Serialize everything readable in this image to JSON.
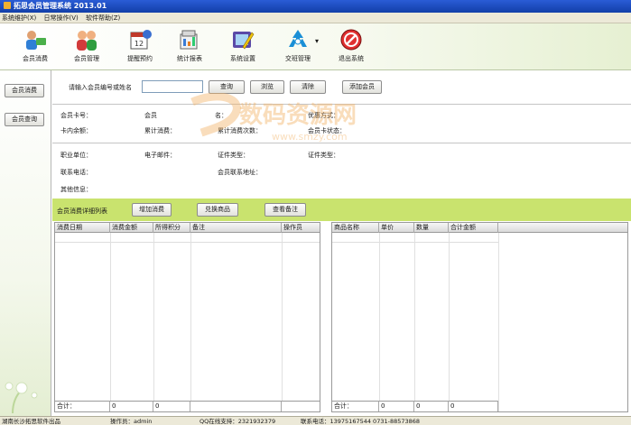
{
  "window": {
    "title": "拓思会员管理系统  2013.01"
  },
  "menu": [
    "系统维护(X)",
    "日常操作(V)",
    "软件帮助(Z)"
  ],
  "toolbar": [
    {
      "label": "会员消费",
      "icon": "member-consume-icon"
    },
    {
      "label": "会员管理",
      "icon": "member-manage-icon"
    },
    {
      "label": "提醒预约",
      "icon": "calendar-reminder-icon"
    },
    {
      "label": "统计报表",
      "icon": "report-icon"
    },
    {
      "label": "系统设置",
      "icon": "settings-icon"
    },
    {
      "label": "交班管理",
      "icon": "shift-handover-icon"
    },
    {
      "label": "退出系统",
      "icon": "exit-icon"
    }
  ],
  "leftnav": [
    "会员消费",
    "会员查询"
  ],
  "search": {
    "prompt": "请输入会员编号或姓名",
    "value": "",
    "query_label": "查询",
    "browse_label": "浏览",
    "clear_label": "清除",
    "add_label": "添加会员"
  },
  "info": {
    "card_no": "会员卡号：",
    "member_x": "会员",
    "name_x": "名：",
    "discount": "优惠方式：",
    "balance": "卡内余额：",
    "total_consume": "累计消费：",
    "total_count": "累计消费次数：",
    "card_status": "会员卡状态：",
    "work_unit": "职业单位：",
    "email": "电子邮件：",
    "id_type": "证件类型：",
    "id_type2": "证件类型：",
    "phone": "联系电话：",
    "address": "会员联系地址：",
    "other": "其他信息："
  },
  "details": {
    "title": "会员消费详细列表",
    "add_consume": "增加消费",
    "redeem": "兑换商品",
    "view_note": "查看备注"
  },
  "left_grid": {
    "headers": [
      "消费日期",
      "消费金额",
      "所得积分",
      "备注",
      "操作员"
    ],
    "footer": [
      "合计：",
      "0",
      "0"
    ]
  },
  "right_grid": {
    "headers": [
      "商品名称",
      "单价",
      "数量",
      "合计金额"
    ],
    "footer": [
      "合计：",
      "0",
      "0",
      "0"
    ]
  },
  "status": {
    "company": "湖南长沙拓思软件出品",
    "operator": "操作员：admin",
    "qq": "QQ在线支持：2321932379",
    "phone": "联系电话：13975167544  0731-88573868"
  },
  "watermark": {
    "text": "数码资源网",
    "url": "www.smzy.com"
  },
  "colors": {
    "title_bar": "#1c48c4",
    "green_bar": "#c9e36e"
  }
}
